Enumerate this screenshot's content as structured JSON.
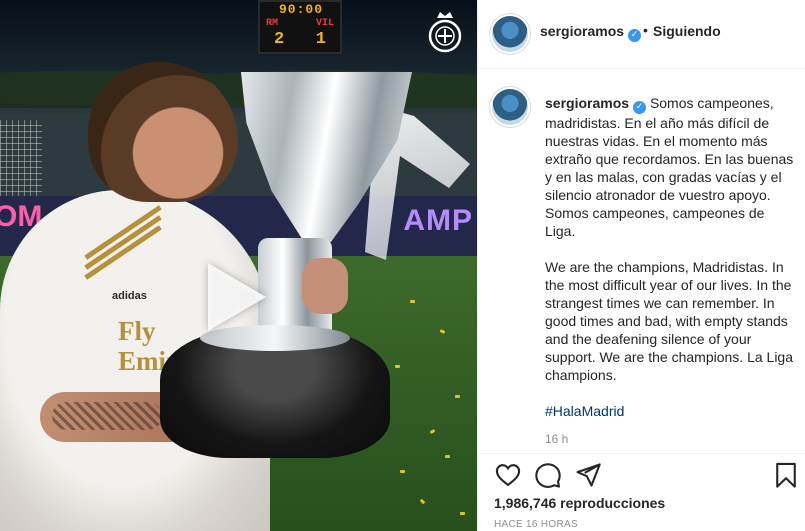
{
  "media": {
    "scoreboard": {
      "time": "90:00",
      "team_home": "RM",
      "team_away": "VIL",
      "score_home": "2",
      "score_away": "1"
    },
    "adboard_left": "OM",
    "adboard_right": "AMP",
    "sponsor_line1": "Fly",
    "sponsor_line2": "Emir",
    "kit_brand": "adidas",
    "play_icon": "play-icon"
  },
  "header": {
    "username": "sergioramos",
    "separator": "•",
    "follow_status": "Siguiendo"
  },
  "caption": {
    "username": "sergioramos",
    "paragraph_es": "Somos campeones, madridistas. En el año más difícil de nuestras vidas. En el momento más extraño que recordamos. En las buenas y en las malas, con gradas vacías y el silencio atronador de vuestro apoyo. Somos campeones, campeones de Liga.",
    "paragraph_en": "We are the champions, Madridistas. In the most difficult year of our lives. In the strangest times we can remember. In good times and bad, with empty stands and the deafening silence of your support. We are the champions. La Liga champions.",
    "hashtag": "#HalaMadrid",
    "time_ago": "16 h"
  },
  "actions": {
    "icons": [
      "heart-icon",
      "comment-icon",
      "share-icon",
      "bookmark-icon"
    ],
    "views": "1,986,746 reproducciones",
    "posted": "HACE 16 HORAS"
  },
  "colors": {
    "link": "#003569",
    "verified": "#3897f0",
    "muted": "#8e8e8e",
    "text": "#262626"
  }
}
